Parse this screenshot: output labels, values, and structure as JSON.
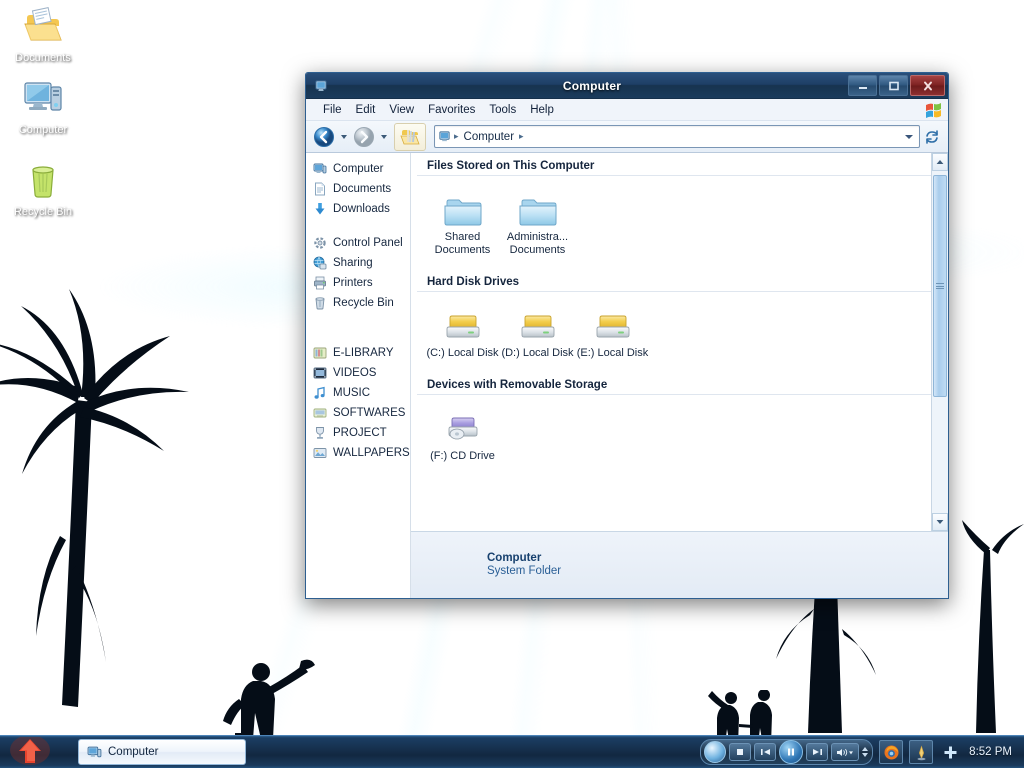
{
  "desktop": {
    "icons": [
      {
        "label": "Documents",
        "icon": "documents-folder-icon"
      },
      {
        "label": "Computer",
        "icon": "computer-icon"
      },
      {
        "label": "Recycle Bin",
        "icon": "recycle-bin-icon"
      }
    ]
  },
  "window": {
    "title": "Computer",
    "title_icon": "computer-small-icon",
    "controls": {
      "minimize": "Minimize",
      "maximize": "Maximize",
      "close": "Close"
    },
    "menubar": [
      {
        "label": "File"
      },
      {
        "label": "Edit"
      },
      {
        "label": "View"
      },
      {
        "label": "Favorites"
      },
      {
        "label": "Tools"
      },
      {
        "label": "Help"
      }
    ],
    "toolbar": {
      "back": "Back",
      "forward": "Forward",
      "views": "Views",
      "refresh": "Refresh"
    },
    "address": {
      "icon": "computer-small-icon",
      "crumbs": [
        "Computer"
      ],
      "dropdown": "Previous locations"
    },
    "sidebar": {
      "groups": [
        {
          "items": [
            {
              "label": "Computer",
              "icon": "computer-icon"
            },
            {
              "label": "Documents",
              "icon": "documents-icon"
            },
            {
              "label": "Downloads",
              "icon": "downloads-icon"
            }
          ]
        },
        {
          "items": [
            {
              "label": "Control Panel",
              "icon": "control-panel-icon"
            },
            {
              "label": "Sharing",
              "icon": "sharing-icon"
            },
            {
              "label": "Printers",
              "icon": "printers-icon"
            },
            {
              "label": "Recycle Bin",
              "icon": "recycle-bin-icon"
            }
          ]
        },
        {
          "items": [
            {
              "label": "E-LIBRARY",
              "icon": "library-folder-icon"
            },
            {
              "label": "VIDEOS",
              "icon": "videos-folder-icon"
            },
            {
              "label": "MUSIC",
              "icon": "music-folder-icon"
            },
            {
              "label": "SOFTWARES",
              "icon": "software-folder-icon"
            },
            {
              "label": "PROJECT",
              "icon": "project-folder-icon"
            },
            {
              "label": "WALLPAPERS",
              "icon": "wallpapers-folder-icon"
            }
          ]
        }
      ]
    },
    "content": {
      "sections": [
        {
          "heading": "Files Stored on This Computer",
          "items": [
            {
              "label": "Shared Documents",
              "icon": "folder-icon"
            },
            {
              "label": "Administra... Documents",
              "icon": "folder-icon"
            }
          ]
        },
        {
          "heading": "Hard Disk Drives",
          "items": [
            {
              "label": "(C:) Local Disk",
              "icon": "hard-drive-icon"
            },
            {
              "label": "(D:) Local Disk",
              "icon": "hard-drive-icon"
            },
            {
              "label": "(E:) Local Disk",
              "icon": "hard-drive-icon"
            }
          ]
        },
        {
          "heading": "Devices with Removable Storage",
          "items": [
            {
              "label": "(F:) CD Drive",
              "icon": "cd-drive-icon"
            }
          ]
        }
      ]
    },
    "statusbar": {
      "title": "Computer",
      "subtitle": "System Folder"
    }
  },
  "taskbar": {
    "start_button": "Start",
    "tasks": [
      {
        "label": "Computer",
        "icon": "computer-small-icon"
      }
    ],
    "media": {
      "logo": "media-player-logo",
      "stop": "Stop",
      "previous": "Previous",
      "play_pause": "Pause",
      "next": "Next",
      "volume": "Volume"
    },
    "tray": [
      {
        "name": "firefox-icon"
      },
      {
        "name": "app-icon"
      },
      {
        "name": "network-icon"
      }
    ],
    "clock": "8:52 PM"
  },
  "colors": {
    "titlebar": "#1e3f66",
    "close_button": "#7e2222",
    "accent": "#2a5f96",
    "desktop_top": "#15416d",
    "desktop_bottom": "#92dbf2"
  }
}
